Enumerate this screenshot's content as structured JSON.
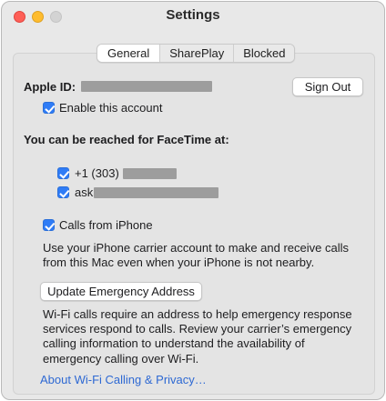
{
  "window": {
    "title": "Settings"
  },
  "tabs": [
    {
      "label": "General",
      "active": true
    },
    {
      "label": "SharePlay",
      "active": false
    },
    {
      "label": "Blocked",
      "active": false
    }
  ],
  "account": {
    "apple_id_label": "Apple ID:",
    "sign_out_label": "Sign Out",
    "enable_account_label": "Enable this account",
    "enable_account_checked": true
  },
  "reach": {
    "heading": "You can be reached for FaceTime at:",
    "items": [
      {
        "text": "+1 (303)",
        "checked": true
      },
      {
        "text": "ask",
        "checked": true
      }
    ]
  },
  "calls": {
    "label": "Calls from iPhone",
    "checked": true,
    "description": "Use your iPhone carrier account to make and receive calls from this Mac even when your iPhone is not nearby."
  },
  "emergency": {
    "button_label": "Update Emergency Address",
    "description": "Wi-Fi calls require an address to help emergency response services respond to calls.  Review your carrier’s emergency calling information to understand the availability of emergency calling over Wi-Fi."
  },
  "footer": {
    "link_label": "About Wi-Fi Calling & Privacy…"
  },
  "colors": {
    "accent": "#2f7cf6",
    "link": "#2e69d3",
    "redaction": "#9d9d9d"
  }
}
